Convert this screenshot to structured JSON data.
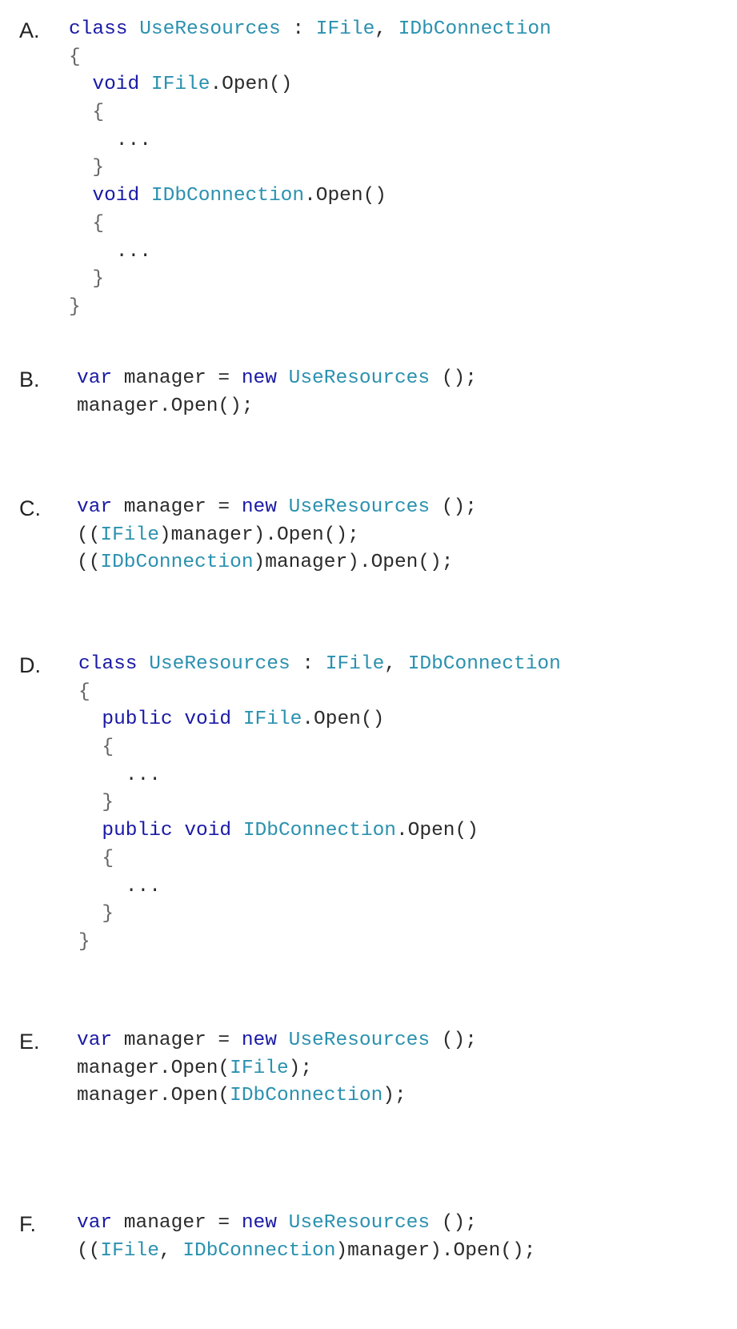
{
  "colors": {
    "keyword": "#1a1aa6",
    "type": "#2b91af",
    "plain": "#2b2b2b",
    "brace": "#666666"
  },
  "options": [
    {
      "letter": "A.",
      "lines": [
        [
          {
            "t": "class",
            "k": "kw"
          },
          {
            "t": " ",
            "k": "plain"
          },
          {
            "t": "UseResources",
            "k": "type"
          },
          {
            "t": " : ",
            "k": "plain"
          },
          {
            "t": "IFile",
            "k": "type"
          },
          {
            "t": ", ",
            "k": "plain"
          },
          {
            "t": "IDbConnection",
            "k": "type"
          }
        ],
        [
          {
            "t": "{",
            "k": "brace"
          }
        ],
        [
          {
            "t": "  ",
            "k": "plain"
          },
          {
            "t": "void",
            "k": "kw"
          },
          {
            "t": " ",
            "k": "plain"
          },
          {
            "t": "IFile",
            "k": "type"
          },
          {
            "t": ".Open()",
            "k": "plain"
          }
        ],
        [
          {
            "t": "  ",
            "k": "plain"
          },
          {
            "t": "{",
            "k": "brace"
          }
        ],
        [
          {
            "t": "    ...",
            "k": "plain"
          }
        ],
        [
          {
            "t": "  ",
            "k": "plain"
          },
          {
            "t": "}",
            "k": "brace"
          }
        ],
        [
          {
            "t": "  ",
            "k": "plain"
          },
          {
            "t": "void",
            "k": "kw"
          },
          {
            "t": " ",
            "k": "plain"
          },
          {
            "t": "IDbConnection",
            "k": "type"
          },
          {
            "t": ".Open()",
            "k": "plain"
          }
        ],
        [
          {
            "t": "  ",
            "k": "plain"
          },
          {
            "t": "{",
            "k": "brace"
          }
        ],
        [
          {
            "t": "    ...",
            "k": "plain"
          }
        ],
        [
          {
            "t": "  ",
            "k": "plain"
          },
          {
            "t": "}",
            "k": "brace"
          }
        ],
        [
          {
            "t": "}",
            "k": "brace"
          }
        ]
      ]
    },
    {
      "letter": "B.",
      "lines": [
        [
          {
            "t": "var",
            "k": "kw"
          },
          {
            "t": " manager = ",
            "k": "plain"
          },
          {
            "t": "new",
            "k": "kw"
          },
          {
            "t": " ",
            "k": "plain"
          },
          {
            "t": "UseResources",
            "k": "type"
          },
          {
            "t": " ();",
            "k": "plain"
          }
        ],
        [
          {
            "t": "manager.Open();",
            "k": "plain"
          }
        ]
      ]
    },
    {
      "letter": "C.",
      "lines": [
        [
          {
            "t": "var",
            "k": "kw"
          },
          {
            "t": " manager = ",
            "k": "plain"
          },
          {
            "t": "new",
            "k": "kw"
          },
          {
            "t": " ",
            "k": "plain"
          },
          {
            "t": "UseResources",
            "k": "type"
          },
          {
            "t": " ();",
            "k": "plain"
          }
        ],
        [
          {
            "t": "((",
            "k": "plain"
          },
          {
            "t": "IFile",
            "k": "type"
          },
          {
            "t": ")manager).Open();",
            "k": "plain"
          }
        ],
        [
          {
            "t": "((",
            "k": "plain"
          },
          {
            "t": "IDbConnection",
            "k": "type"
          },
          {
            "t": ")manager).Open();",
            "k": "plain"
          }
        ]
      ]
    },
    {
      "letter": "D.",
      "lines": [
        [
          {
            "t": "class",
            "k": "kw"
          },
          {
            "t": " ",
            "k": "plain"
          },
          {
            "t": "UseResources",
            "k": "type"
          },
          {
            "t": " : ",
            "k": "plain"
          },
          {
            "t": "IFile",
            "k": "type"
          },
          {
            "t": ", ",
            "k": "plain"
          },
          {
            "t": "IDbConnection",
            "k": "type"
          }
        ],
        [
          {
            "t": "{",
            "k": "brace"
          }
        ],
        [
          {
            "t": "  ",
            "k": "plain"
          },
          {
            "t": "public",
            "k": "kw"
          },
          {
            "t": " ",
            "k": "plain"
          },
          {
            "t": "void",
            "k": "kw"
          },
          {
            "t": " ",
            "k": "plain"
          },
          {
            "t": "IFile",
            "k": "type"
          },
          {
            "t": ".Open()",
            "k": "plain"
          }
        ],
        [
          {
            "t": "  ",
            "k": "plain"
          },
          {
            "t": "{",
            "k": "brace"
          }
        ],
        [
          {
            "t": "    ...",
            "k": "plain"
          }
        ],
        [
          {
            "t": "  ",
            "k": "plain"
          },
          {
            "t": "}",
            "k": "brace"
          }
        ],
        [
          {
            "t": "  ",
            "k": "plain"
          },
          {
            "t": "public",
            "k": "kw"
          },
          {
            "t": " ",
            "k": "plain"
          },
          {
            "t": "void",
            "k": "kw"
          },
          {
            "t": " ",
            "k": "plain"
          },
          {
            "t": "IDbConnection",
            "k": "type"
          },
          {
            "t": ".Open()",
            "k": "plain"
          }
        ],
        [
          {
            "t": "  ",
            "k": "plain"
          },
          {
            "t": "{",
            "k": "brace"
          }
        ],
        [
          {
            "t": "    ...",
            "k": "plain"
          }
        ],
        [
          {
            "t": "  ",
            "k": "plain"
          },
          {
            "t": "}",
            "k": "brace"
          }
        ],
        [
          {
            "t": "}",
            "k": "brace"
          }
        ]
      ]
    },
    {
      "letter": "E.",
      "lines": [
        [
          {
            "t": "var",
            "k": "kw"
          },
          {
            "t": " manager = ",
            "k": "plain"
          },
          {
            "t": "new",
            "k": "kw"
          },
          {
            "t": " ",
            "k": "plain"
          },
          {
            "t": "UseResources",
            "k": "type"
          },
          {
            "t": " ();",
            "k": "plain"
          }
        ],
        [
          {
            "t": "manager.Open(",
            "k": "plain"
          },
          {
            "t": "IFile",
            "k": "type"
          },
          {
            "t": ");",
            "k": "plain"
          }
        ],
        [
          {
            "t": "manager.Open(",
            "k": "plain"
          },
          {
            "t": "IDbConnection",
            "k": "type"
          },
          {
            "t": ");",
            "k": "plain"
          }
        ]
      ]
    },
    {
      "letter": "F.",
      "lines": [
        [
          {
            "t": "var",
            "k": "kw"
          },
          {
            "t": " manager = ",
            "k": "plain"
          },
          {
            "t": "new",
            "k": "kw"
          },
          {
            "t": " ",
            "k": "plain"
          },
          {
            "t": "UseResources",
            "k": "type"
          },
          {
            "t": " ();",
            "k": "plain"
          }
        ],
        [
          {
            "t": "((",
            "k": "plain"
          },
          {
            "t": "IFile",
            "k": "type"
          },
          {
            "t": ", ",
            "k": "plain"
          },
          {
            "t": "IDbConnection",
            "k": "type"
          },
          {
            "t": ")manager).Open();",
            "k": "plain"
          }
        ]
      ]
    }
  ]
}
